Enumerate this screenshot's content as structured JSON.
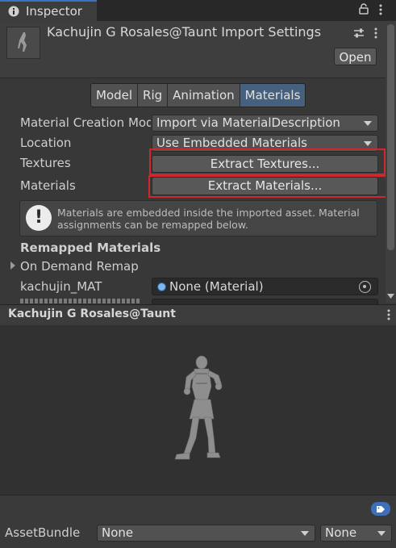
{
  "window": {
    "tab_label": "Inspector"
  },
  "header": {
    "title": "Kachujin G Rosales@Taunt Import Settings",
    "open_label": "Open"
  },
  "tabs": [
    {
      "label": "Model",
      "active": false
    },
    {
      "label": "Rig",
      "active": false
    },
    {
      "label": "Animation",
      "active": false
    },
    {
      "label": "Materials",
      "active": true
    }
  ],
  "fields": {
    "material_creation_mode": {
      "label": "Material Creation Mode",
      "value": "Import via MaterialDescription"
    },
    "location": {
      "label": "Location",
      "value": "Use Embedded Materials"
    },
    "textures": {
      "label": "Textures",
      "button": "Extract Textures..."
    },
    "materials": {
      "label": "Materials",
      "button": "Extract Materials..."
    }
  },
  "help_box": {
    "text": "Materials are embedded inside the imported asset. Material assignments can be remapped below."
  },
  "remapped": {
    "heading": "Remapped Materials",
    "on_demand_label": "On Demand Remap",
    "items": [
      {
        "label": "kachujin_MAT",
        "value": "None (Material)"
      }
    ]
  },
  "preview": {
    "title": "Kachujin G Rosales@Taunt"
  },
  "asset_bundle": {
    "label": "AssetBundle",
    "name_value": "None",
    "variant_value": "None"
  },
  "colors": {
    "highlight_red": "#d0262e",
    "active_tab": "#45617d",
    "accent_blue": "#3a72c9"
  }
}
